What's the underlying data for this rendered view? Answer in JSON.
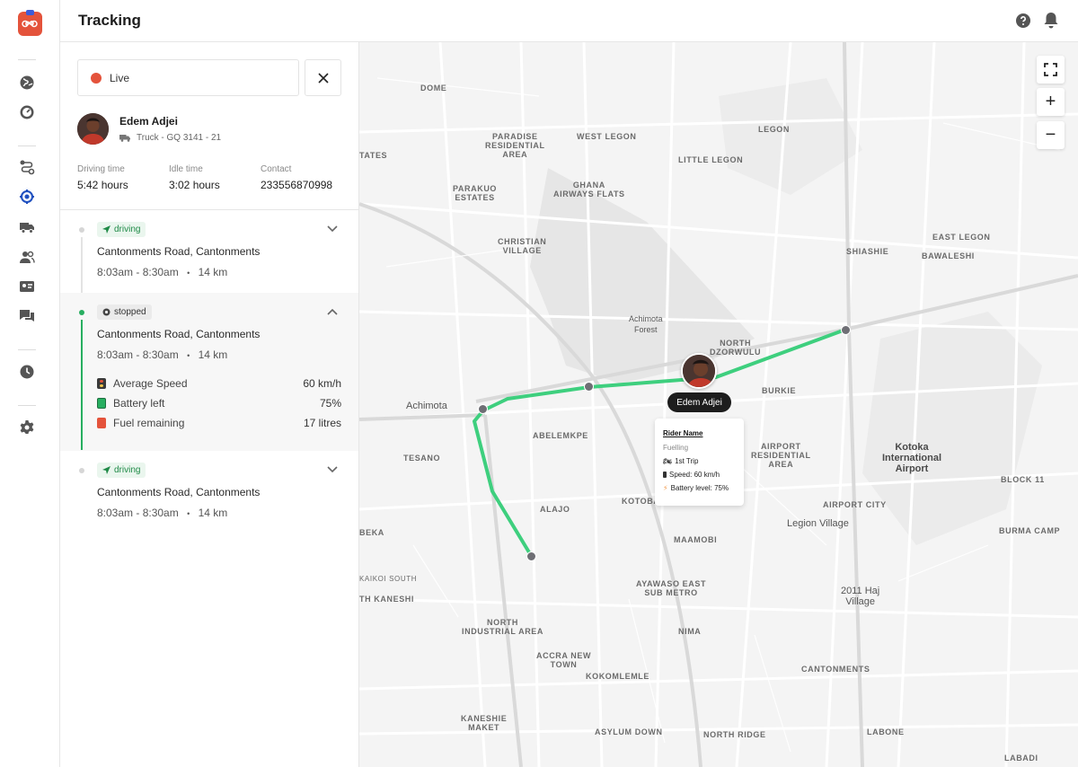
{
  "header": {
    "title": "Tracking"
  },
  "rail": {
    "icons": [
      "logo-icon",
      "globe-icon",
      "gauge-icon",
      "route-icon",
      "tracking-icon",
      "truck-icon",
      "users-icon",
      "id-card-icon",
      "chat-icon",
      "clock-icon",
      "settings-icon"
    ]
  },
  "tracker": {
    "status": "Live",
    "rider": {
      "name": "Edem Adjei",
      "vehicle": "Truck - GQ 3141 - 21"
    },
    "stats": [
      {
        "label": "Driving time",
        "value": "5:42 hours"
      },
      {
        "label": "Idle time",
        "value": "3:02 hours"
      },
      {
        "label": "Contact",
        "value": "233556870998"
      }
    ],
    "trips": [
      {
        "status": "driving",
        "location": "Cantonments Road, Cantonments",
        "time": "8:03am - 8:30am",
        "sep": "•",
        "distance": "14 km"
      },
      {
        "status": "stopped",
        "location": "Cantonments Road, Cantonments",
        "time": "8:03am - 8:30am",
        "sep": "•",
        "distance": "14 km",
        "metrics": [
          {
            "label": "Average Speed",
            "value": "60 km/h"
          },
          {
            "label": "Battery left",
            "value": "75%"
          },
          {
            "label": "Fuel remaining",
            "value": "17 litres"
          }
        ]
      },
      {
        "status": "driving",
        "location": "Cantonments Road, Cantonments",
        "time": "8:03am - 8:30am",
        "sep": "•",
        "distance": "14 km"
      }
    ]
  },
  "map": {
    "controls": {
      "fullscreen": "fullscreen-icon",
      "zoom_in": "+",
      "zoom_out": "−"
    },
    "marker": {
      "name": "Edem Adjei"
    },
    "popup": {
      "title": "Rider Name",
      "status": "Fuelling",
      "trip": "1st Trip",
      "speed": "Speed: 60 km/h",
      "battery": "Battery level: 75%"
    },
    "districts": {
      "dome": "DOME",
      "paradise": "PARADISE\nRESIDENTIAL\nAREA",
      "west_legon": "WEST LEGON",
      "legon": "LEGON",
      "little_legon": "LITTLE LEGON",
      "tates": "TATES",
      "parakuo": "PARAKUO\nESTATES",
      "ghana_airways": "GHANA\nAIRWAYS FLATS",
      "christian": "CHRISTIAN\nVILLAGE",
      "shiashie": "SHIASHIE",
      "east_legon": "EAST LEGON",
      "bawaleshi": "BAWALESHI",
      "north_dzorwulu": "NORTH\nDZORWULU",
      "burkie": "BURKIE",
      "abelemkpe": "ABELEMKPE",
      "airport_res": "AIRPORT\nRESIDENTIAL\nAREA",
      "tesano": "TESANO",
      "block11": "BLOCK 11",
      "kotobabi": "KOTOBA",
      "alajo": "ALAJO",
      "airport_city": "AIRPORT CITY",
      "burma_camp": "BURMA CAMP",
      "beka": "BEKA",
      "maamobi": "MAAMOBI",
      "kaikoi": "KAIKOI SOUTH",
      "ayawaso": "AYAWASO EAST\nSUB METRO",
      "kaneshi": "TH KANESHI",
      "north_industrial": "NORTH\nINDUSTRIAL AREA",
      "nima": "NIMA",
      "accra_new_town": "ACCRA NEW\nTOWN",
      "kokomlemle": "KOKOMLEMLE",
      "cantonments": "CANTONMENTS",
      "kaneshie_market": "KANESHIE\nMAKET",
      "asylum_down": "ASYLUM DOWN",
      "north_ridge": "NORTH RIDGE",
      "labone": "LABONE",
      "labadi": "LABADI"
    },
    "places": {
      "achimota": "Achimota",
      "achimota_forest": "Achimota\nForest",
      "kotoka": "Kotoka\nInternational\nAirport",
      "legion_village": "Legion Village",
      "haj_village": "2011 Haj\nVillage"
    }
  }
}
